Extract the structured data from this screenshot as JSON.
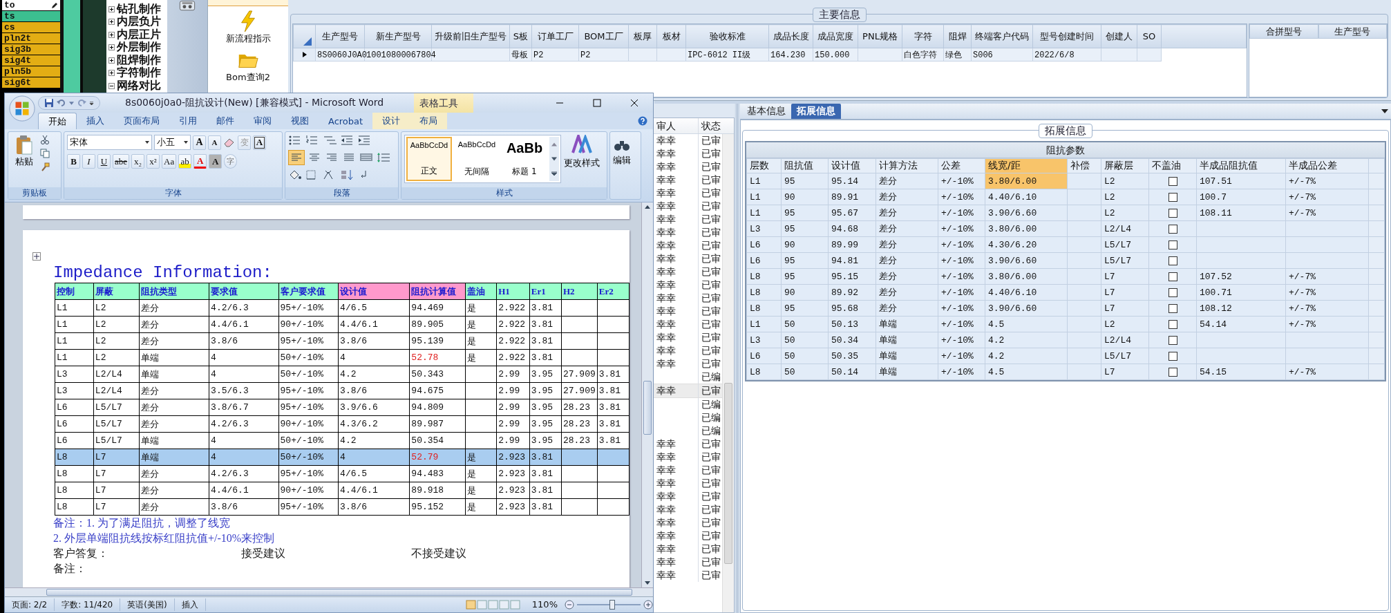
{
  "layer_list": {
    "items": [
      {
        "label": "to",
        "color": "#ffffff",
        "selected": true
      },
      {
        "label": "ts",
        "color": "#3cbf90",
        "selected": false
      },
      {
        "label": "cs",
        "color": "#e3ad14",
        "selected": false
      },
      {
        "label": "pln2t",
        "color": "#e3ad14",
        "selected": false
      },
      {
        "label": "sig3b",
        "color": "#e3ad14",
        "selected": false
      },
      {
        "label": "sig4t",
        "color": "#e3ad14",
        "selected": false
      },
      {
        "label": "pln5b",
        "color": "#e3ad14",
        "selected": false
      },
      {
        "label": "sig6t",
        "color": "#e3ad14",
        "selected": false
      }
    ]
  },
  "process_tree": {
    "items": [
      {
        "label": "钻孔制作",
        "expanded": false
      },
      {
        "label": "内层负片",
        "expanded": false
      },
      {
        "label": "内层正片",
        "expanded": false
      },
      {
        "label": "外层制作",
        "expanded": false
      },
      {
        "label": "阻焊制作",
        "expanded": false
      },
      {
        "label": "字符制作",
        "expanded": false
      },
      {
        "label": "网络对比",
        "expanded": true
      }
    ]
  },
  "launcher": {
    "items": [
      {
        "label": "新流程指示",
        "kind": "lightning"
      },
      {
        "label": "Bom查询2",
        "kind": "folder"
      }
    ]
  },
  "main_info": {
    "title": "主要信息",
    "columns": [
      "生产型号",
      "新生产型号",
      "升级前旧生产型号",
      "S板",
      "订单工厂",
      "BOM工厂",
      "板厚",
      "板材",
      "验收标准",
      "成品长度",
      "成品宽度",
      "PNL规格",
      "字符",
      "阻焊",
      "终端客户代码",
      "型号创建时间",
      "创建人",
      "SO"
    ],
    "rows": [
      {
        "selected": true,
        "cells": [
          "8S0060J0A0",
          "10010800067804",
          null,
          "母板",
          "P2",
          "P2",
          null,
          null,
          "IPC-6012 II级",
          "164.230",
          "150.000",
          null,
          "白色字符",
          "绿色",
          "S006",
          "2022/6/8",
          null,
          null
        ]
      }
    ]
  },
  "merge_table": {
    "columns": [
      "合拼型号",
      "生产型号"
    ]
  },
  "review_list": {
    "columns": [
      "审人",
      "状态"
    ],
    "rows": [
      {
        "reviewer": "幸幸",
        "status": "已审",
        "selected": false
      },
      {
        "reviewer": "幸幸",
        "status": "已审",
        "selected": false
      },
      {
        "reviewer": "幸幸",
        "status": "已审",
        "selected": false
      },
      {
        "reviewer": "幸幸",
        "status": "已审",
        "selected": false
      },
      {
        "reviewer": "幸幸",
        "status": "已审",
        "selected": false
      },
      {
        "reviewer": "幸幸",
        "status": "已审",
        "selected": false
      },
      {
        "reviewer": "幸幸",
        "status": "已审",
        "selected": false
      },
      {
        "reviewer": "幸幸",
        "status": "已审",
        "selected": false
      },
      {
        "reviewer": "幸幸",
        "status": "已审",
        "selected": false
      },
      {
        "reviewer": "幸幸",
        "status": "已审",
        "selected": false
      },
      {
        "reviewer": "幸幸",
        "status": "已审",
        "selected": false
      },
      {
        "reviewer": "幸幸",
        "status": "已审",
        "selected": false
      },
      {
        "reviewer": "幸幸",
        "status": "已审",
        "selected": false
      },
      {
        "reviewer": "幸幸",
        "status": "已审",
        "selected": false
      },
      {
        "reviewer": "幸幸",
        "status": "已审",
        "selected": false
      },
      {
        "reviewer": "幸幸",
        "status": "已审",
        "selected": false
      },
      {
        "reviewer": "幸幸",
        "status": "已审",
        "selected": false
      },
      {
        "reviewer": "幸幸",
        "status": "已审",
        "selected": false
      },
      {
        "status": "已编",
        "selected": false
      },
      {
        "reviewer": "幸幸",
        "status": "已审",
        "selected": true
      },
      {
        "status": "已编",
        "selected": false
      },
      {
        "status": "已编",
        "selected": false
      },
      {
        "status": "已编",
        "selected": false
      },
      {
        "reviewer": "幸幸",
        "status": "已审",
        "selected": false
      },
      {
        "reviewer": "幸幸",
        "status": "已审",
        "selected": false
      },
      {
        "reviewer": "幸幸",
        "status": "已审",
        "selected": false
      },
      {
        "reviewer": "幸幸",
        "status": "已审",
        "selected": false
      },
      {
        "reviewer": "幸幸",
        "status": "已审",
        "selected": false
      },
      {
        "reviewer": "幸幸",
        "status": "已审",
        "selected": false
      },
      {
        "reviewer": "幸幸",
        "status": "已审",
        "selected": false
      },
      {
        "reviewer": "幸幸",
        "status": "已审",
        "selected": false
      },
      {
        "reviewer": "幸幸",
        "status": "已审",
        "selected": false
      },
      {
        "reviewer": "幸幸",
        "status": "已审",
        "selected": false
      },
      {
        "reviewer": "幸幸",
        "status": "已审",
        "selected": false
      }
    ]
  },
  "detail_tabs": [
    {
      "label": "基本信息",
      "selected": false
    },
    {
      "label": "拓展信息",
      "selected": true
    }
  ],
  "extended_info": {
    "title": "拓展信息",
    "table": {
      "title": "阻抗参数",
      "columns": [
        {
          "label": "层数",
          "kind": "text",
          "selected": false
        },
        {
          "label": "阻抗值",
          "kind": "text",
          "selected": false
        },
        {
          "label": "设计值",
          "kind": "text",
          "selected": false
        },
        {
          "label": "计算方法",
          "kind": "text",
          "selected": false
        },
        {
          "label": "公差",
          "kind": "text",
          "selected": false
        },
        {
          "label": "线宽/距",
          "kind": "text",
          "selected": true
        },
        {
          "label": "补偿",
          "kind": "text",
          "selected": false
        },
        {
          "label": "屏蔽层",
          "kind": "text",
          "selected": false
        },
        {
          "label": "不盖油",
          "kind": "checkbox",
          "selected": false
        },
        {
          "label": "半成品阻抗值",
          "kind": "text",
          "selected": false
        },
        {
          "label": "半成品公差",
          "kind": "text",
          "selected": false
        }
      ],
      "rows": [
        {
          "selected": true,
          "no_oil_cover": false,
          "cells": [
            "L1",
            "95",
            "95.14",
            "差分",
            "+/-10%",
            "3.80/6.00",
            null,
            "L2",
            null,
            "107.51",
            "+/-7%"
          ]
        },
        {
          "selected": false,
          "no_oil_cover": false,
          "cells": [
            "L1",
            "90",
            "89.91",
            "差分",
            "+/-10%",
            "4.40/6.10",
            null,
            "L2",
            null,
            "100.7",
            "+/-7%"
          ]
        },
        {
          "selected": false,
          "no_oil_cover": false,
          "cells": [
            "L1",
            "95",
            "95.67",
            "差分",
            "+/-10%",
            "3.90/6.60",
            null,
            "L2",
            null,
            "108.11",
            "+/-7%"
          ]
        },
        {
          "selected": false,
          "no_oil_cover": false,
          "cells": [
            "L3",
            "95",
            "94.68",
            "差分",
            "+/-10%",
            "3.80/6.00",
            null,
            "L2/L4",
            null,
            null,
            null
          ]
        },
        {
          "selected": false,
          "no_oil_cover": false,
          "cells": [
            "L6",
            "90",
            "89.99",
            "差分",
            "+/-10%",
            "4.30/6.20",
            null,
            "L5/L7",
            null,
            null,
            null
          ]
        },
        {
          "selected": false,
          "no_oil_cover": false,
          "cells": [
            "L6",
            "95",
            "94.81",
            "差分",
            "+/-10%",
            "3.90/6.60",
            null,
            "L5/L7",
            null,
            null,
            null
          ]
        },
        {
          "selected": false,
          "no_oil_cover": false,
          "cells": [
            "L8",
            "95",
            "95.15",
            "差分",
            "+/-10%",
            "3.80/6.00",
            null,
            "L7",
            null,
            "107.52",
            "+/-7%"
          ]
        },
        {
          "selected": false,
          "no_oil_cover": false,
          "cells": [
            "L8",
            "90",
            "89.92",
            "差分",
            "+/-10%",
            "4.40/6.10",
            null,
            "L7",
            null,
            "100.71",
            "+/-7%"
          ]
        },
        {
          "selected": false,
          "no_oil_cover": false,
          "cells": [
            "L8",
            "95",
            "95.68",
            "差分",
            "+/-10%",
            "3.90/6.60",
            null,
            "L7",
            null,
            "108.12",
            "+/-7%"
          ]
        },
        {
          "selected": false,
          "no_oil_cover": false,
          "cells": [
            "L1",
            "50",
            "50.13",
            "单端",
            "+/-10%",
            "4.5",
            null,
            "L2",
            null,
            "54.14",
            "+/-7%"
          ]
        },
        {
          "selected": false,
          "no_oil_cover": false,
          "cells": [
            "L3",
            "50",
            "50.34",
            "单端",
            "+/-10%",
            "4.2",
            null,
            "L2/L4",
            null,
            null,
            null
          ]
        },
        {
          "selected": false,
          "no_oil_cover": false,
          "cells": [
            "L6",
            "50",
            "50.35",
            "单端",
            "+/-10%",
            "4.2",
            null,
            "L5/L7",
            null,
            null,
            null
          ]
        },
        {
          "selected": false,
          "no_oil_cover": false,
          "cells": [
            "L8",
            "50",
            "50.14",
            "单端",
            "+/-10%",
            "4.5",
            null,
            "L7",
            null,
            "54.15",
            "+/-7%"
          ]
        }
      ]
    }
  },
  "word": {
    "title": "8s0060j0a0-阻抗设计(New) [兼容模式] - Microsoft Word",
    "context_tab": "表格工具",
    "tabs": [
      {
        "label": "开始",
        "selected": true,
        "kind": "normal"
      },
      {
        "label": "插入",
        "selected": false,
        "kind": "normal"
      },
      {
        "label": "页面布局",
        "selected": false,
        "kind": "normal"
      },
      {
        "label": "引用",
        "selected": false,
        "kind": "normal"
      },
      {
        "label": "邮件",
        "selected": false,
        "kind": "normal"
      },
      {
        "label": "审阅",
        "selected": false,
        "kind": "normal"
      },
      {
        "label": "视图",
        "selected": false,
        "kind": "normal"
      },
      {
        "label": "Acrobat",
        "selected": false,
        "kind": "normal"
      },
      {
        "label": "设计",
        "selected": false,
        "kind": "context"
      },
      {
        "label": "布局",
        "selected": false,
        "kind": "context"
      }
    ],
    "clipboard": {
      "label": "剪贴板",
      "paste": "粘贴"
    },
    "font": {
      "label": "字体",
      "name": "宋体",
      "size": "小五",
      "tools1": [
        {
          "kind": "grow",
          "label": "A"
        },
        {
          "kind": "shrink",
          "label": "A"
        },
        {
          "kind": "clear"
        },
        {
          "kind": "phonetic",
          "label": "变"
        },
        {
          "kind": "border",
          "label": "A"
        }
      ],
      "tools2": [
        {
          "kind": "bold",
          "label": "B"
        },
        {
          "kind": "italic",
          "label": "I"
        },
        {
          "kind": "underline",
          "label": "U"
        },
        {
          "kind": "strike",
          "label": "abe"
        },
        {
          "kind": "plain",
          "label": "x₂"
        },
        {
          "kind": "plain",
          "label": "x²"
        },
        {
          "kind": "menu",
          "label": "Aa"
        },
        {
          "kind": "highlight",
          "label": "ab"
        },
        {
          "kind": "color",
          "label": "A"
        },
        {
          "kind": "shade",
          "label": "A"
        },
        {
          "kind": "circle",
          "label": "字"
        }
      ]
    },
    "paragraph": {
      "label": "段落",
      "align": [
        {
          "kind": "left",
          "selected": true
        },
        {
          "kind": "center",
          "selected": false
        },
        {
          "kind": "right",
          "selected": false
        },
        {
          "kind": "justify",
          "selected": false
        },
        {
          "kind": "distribute",
          "selected": false
        }
      ]
    },
    "styles": {
      "label": "样式",
      "items": [
        {
          "preview": "AaBbCcDd",
          "name": "正文",
          "kind": "small",
          "selected": true
        },
        {
          "preview": "AaBbCcDd",
          "name": "无间隔",
          "kind": "small",
          "selected": false
        },
        {
          "preview": "AaBb",
          "name": "标题 1",
          "kind": "large",
          "selected": false
        }
      ],
      "change": "更改样式"
    },
    "editing": {
      "label": "编辑"
    },
    "document": {
      "heading": "Impedance Information:",
      "columns": [
        {
          "label": "控制",
          "color": "#99ffcc"
        },
        {
          "label": "屏蔽",
          "color": "#99ffcc"
        },
        {
          "label": "阻抗类型",
          "color": "#99ffcc"
        },
        {
          "label": "要求值",
          "color": "#99ffcc"
        },
        {
          "label": "客户要求值",
          "color": "#99ffcc"
        },
        {
          "label": "设计值",
          "color": "#ff99cc"
        },
        {
          "label": "阻抗计算值",
          "color": "#ff99cc"
        },
        {
          "label": "盖油",
          "color": "#99ffcc"
        },
        {
          "label": "H1",
          "color": "#99ffcc"
        },
        {
          "label": "Er1",
          "color": "#99ffcc"
        },
        {
          "label": "H2",
          "color": "#99ffcc"
        },
        {
          "label": "Er2",
          "color": "#99ffcc"
        }
      ],
      "rows": [
        {
          "selected": false,
          "flagged": false,
          "cells": [
            "L1",
            "L2",
            "差分",
            "4.2/6.3",
            "95+/-10%",
            "4/6.5",
            "94.469",
            "是",
            "2.922",
            "3.81",
            null,
            null
          ]
        },
        {
          "selected": false,
          "flagged": false,
          "cells": [
            "L1",
            "L2",
            "差分",
            "4.4/6.1",
            "90+/-10%",
            "4.4/6.1",
            "89.905",
            "是",
            "2.922",
            "3.81",
            null,
            null
          ]
        },
        {
          "selected": false,
          "flagged": false,
          "cells": [
            "L1",
            "L2",
            "差分",
            "3.8/6",
            "95+/-10%",
            "3.8/6",
            "95.139",
            "是",
            "2.922",
            "3.81",
            null,
            null
          ]
        },
        {
          "selected": false,
          "flagged": true,
          "cells": [
            "L1",
            "L2",
            "单端",
            "4",
            "50+/-10%",
            "4",
            "52.78",
            "是",
            "2.922",
            "3.81",
            null,
            null
          ]
        },
        {
          "selected": false,
          "flagged": false,
          "cells": [
            "L3",
            "L2/L4",
            "单端",
            "4",
            "50+/-10%",
            "4.2",
            "50.343",
            null,
            "2.99",
            "3.95",
            "27.909",
            "3.81"
          ]
        },
        {
          "selected": false,
          "flagged": false,
          "cells": [
            "L3",
            "L2/L4",
            "差分",
            "3.5/6.3",
            "95+/-10%",
            "3.8/6",
            "94.675",
            null,
            "2.99",
            "3.95",
            "27.909",
            "3.81"
          ]
        },
        {
          "selected": false,
          "flagged": false,
          "cells": [
            "L6",
            "L5/L7",
            "差分",
            "3.8/6.7",
            "95+/-10%",
            "3.9/6.6",
            "94.809",
            null,
            "2.99",
            "3.95",
            "28.23",
            "3.81"
          ]
        },
        {
          "selected": false,
          "flagged": false,
          "cells": [
            "L6",
            "L5/L7",
            "差分",
            "4.2/6.3",
            "90+/-10%",
            "4.3/6.2",
            "89.987",
            null,
            "2.99",
            "3.95",
            "28.23",
            "3.81"
          ]
        },
        {
          "selected": false,
          "flagged": false,
          "cells": [
            "L6",
            "L5/L7",
            "单端",
            "4",
            "50+/-10%",
            "4.2",
            "50.354",
            null,
            "2.99",
            "3.95",
            "28.23",
            "3.81"
          ]
        },
        {
          "selected": true,
          "flagged": true,
          "cells": [
            "L8",
            "L7",
            "单端",
            "4",
            "50+/-10%",
            "4",
            "52.79",
            "是",
            "2.923",
            "3.81",
            null,
            null
          ]
        },
        {
          "selected": false,
          "flagged": false,
          "cells": [
            "L8",
            "L7",
            "差分",
            "4.2/6.3",
            "95+/-10%",
            "4/6.5",
            "94.483",
            "是",
            "2.923",
            "3.81",
            null,
            null
          ]
        },
        {
          "selected": false,
          "flagged": false,
          "cells": [
            "L8",
            "L7",
            "差分",
            "4.4/6.1",
            "90+/-10%",
            "4.4/6.1",
            "89.918",
            "是",
            "2.923",
            "3.81",
            null,
            null
          ]
        },
        {
          "selected": false,
          "flagged": false,
          "cells": [
            "L8",
            "L7",
            "差分",
            "3.8/6",
            "95+/-10%",
            "3.8/6",
            "95.152",
            "是",
            "2.923",
            "3.81",
            null,
            null
          ]
        }
      ],
      "remarks": [
        "备注：1. 为了满足阻抗，调整了线宽",
        "2. 外层单端阻抗线按标红阻抗值+/-10%来控制"
      ],
      "reply": {
        "label": "客户答复：",
        "accept": "接受建议",
        "reject": "不接受建议"
      },
      "remark_label": "备注："
    },
    "status_bar": {
      "page": "页面: 2/2",
      "words": "字数: 11/420",
      "language": "英语(美国)",
      "mode": "插入",
      "zoom": "110%",
      "zoom_slider": {
        "level": 0.55
      }
    }
  }
}
